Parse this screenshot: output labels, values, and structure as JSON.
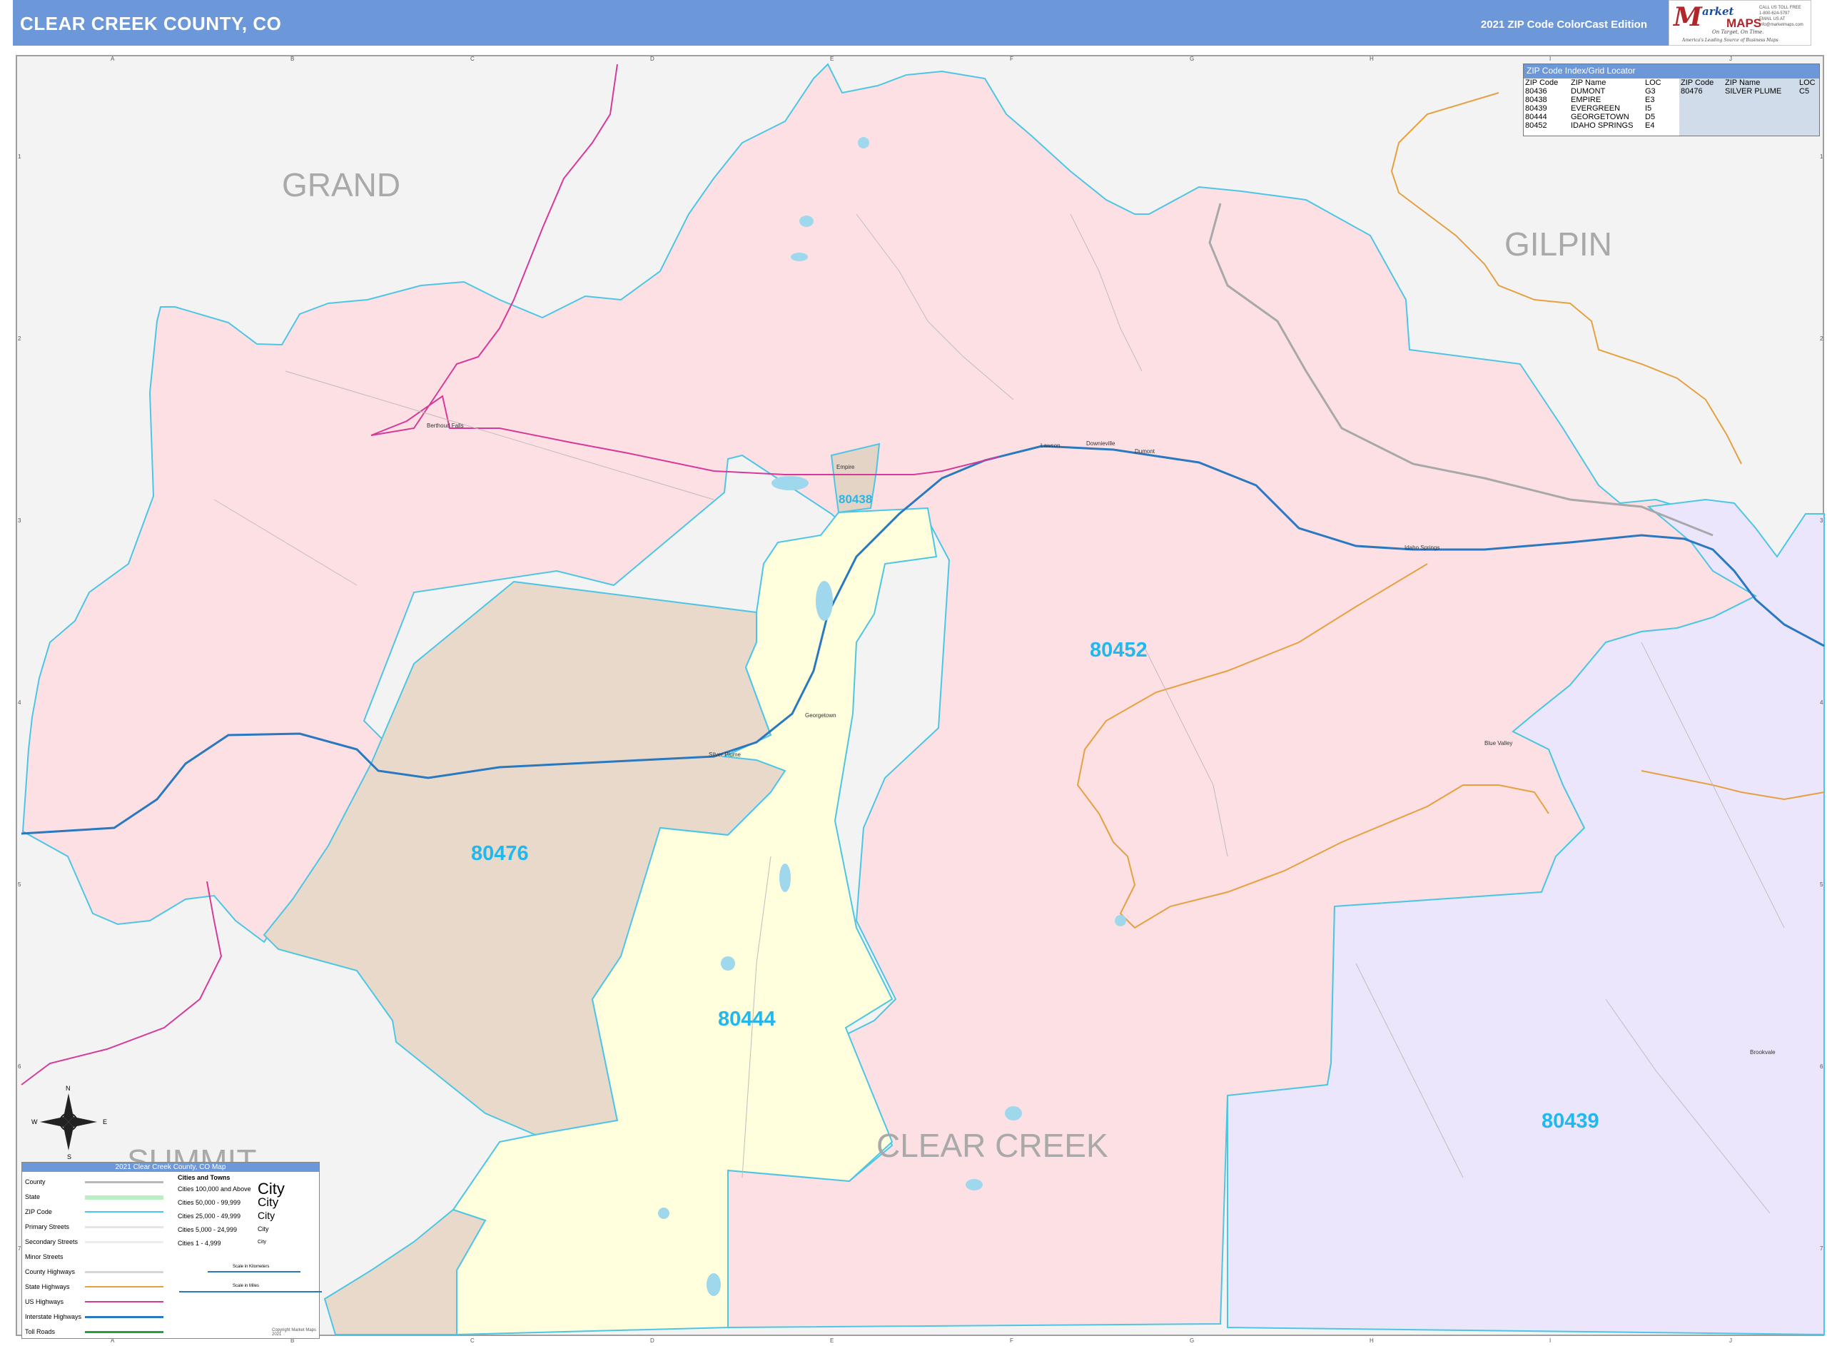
{
  "header": {
    "title": "CLEAR CREEK COUNTY, CO",
    "edition": "2021 ZIP Code ColorCast Edition"
  },
  "logo": {
    "mark": "M",
    "brand_top": "arket",
    "brand_bottom": "MAPS",
    "tagline": "On Target, On Time.",
    "tagline2": "America's Leading Source of Business Maps",
    "contact": [
      "CALL US TOLL FREE",
      "1-800-624-5797",
      "EMAIL US AT",
      "info@marketmaps.com"
    ]
  },
  "grid": {
    "columns": [
      "A",
      "B",
      "C",
      "D",
      "E",
      "F",
      "G",
      "H",
      "I",
      "J"
    ],
    "rows": [
      "1",
      "2",
      "3",
      "4",
      "5",
      "6",
      "7"
    ]
  },
  "counties": {
    "grand": "GRAND",
    "gilpin": "GILPIN",
    "summit": "SUMMIT",
    "clear_creek": "CLEAR CREEK"
  },
  "zip_labels": {
    "z80438": "80438",
    "z80452": "80452",
    "z80476": "80476",
    "z80444": "80444",
    "z80439": "80439"
  },
  "zip_colors": {
    "80452": "#fde0e4",
    "80476": "#e8d9cb",
    "80444": "#fffedd",
    "80439": "#ece6fd",
    "80438": "#e3d4c6",
    "outside": "#f3f3f3",
    "boundary": "#4cc6e4",
    "label": "#22b8ee",
    "interstate": "#2a78c0",
    "us_highway": "#d6399a",
    "state_highway": "#e6a040"
  },
  "towns": {
    "berthoud_falls": "Berthoud Falls",
    "empire": "Empire",
    "lawson": "Lawson",
    "downieville": "Downieville",
    "dumont": "Dumont",
    "idaho_springs": "Idaho Springs",
    "georgetown": "Georgetown",
    "silver_plume": "Silver Plume",
    "blue_valley": "Blue Valley",
    "brookvale": "Brookvale"
  },
  "zip_index": {
    "title": "ZIP Code Index/Grid Locator",
    "headers": [
      "ZIP Code",
      "ZIP Name",
      "LOC",
      "ZIP Code",
      "ZIP Name",
      "LOC"
    ],
    "zips": [
      "80436",
      "80438",
      "80439",
      "80444",
      "80452"
    ],
    "names": [
      "DUMONT",
      "EMPIRE",
      "EVERGREEN",
      "GEORGETOWN",
      "IDAHO SPRINGS"
    ],
    "locs": [
      "G3",
      "E3",
      "I5",
      "D5",
      "E4"
    ],
    "zip2": "80476",
    "name2": "SILVER PLUME",
    "loc2": "C5"
  },
  "legend": {
    "title": "2021 Clear Creek County, CO Map",
    "items": [
      "County",
      "State",
      "ZIP Code",
      "Primary Streets",
      "Secondary Streets",
      "Minor Streets",
      "County Highways",
      "State Highways",
      "US Highways",
      "Interstate Highways",
      "Toll Roads"
    ],
    "cities_title": "Cities and Towns",
    "city_classes": [
      "Cities 100,000 and Above",
      "Cities 50,000 - 99,999",
      "Cities 25,000 - 49,999",
      "Cities 5,000 - 24,999",
      "Cities 1 - 4,999"
    ],
    "city_samples": [
      "City",
      "City",
      "City",
      "City",
      "City"
    ],
    "scale_km": "Scale in Kilometers",
    "scale_mi": "Scale in Miles",
    "footer": "Copyright Market Maps 2021"
  },
  "compass": {
    "n": "N",
    "s": "S",
    "e": "E",
    "w": "W"
  }
}
